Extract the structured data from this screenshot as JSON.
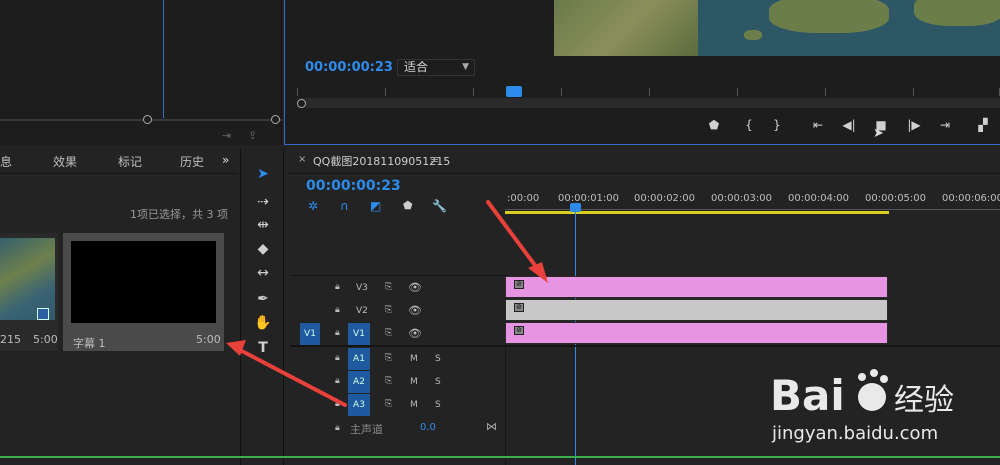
{
  "program_monitor": {
    "timecode": "00:00:00:23",
    "fit_label": "适合"
  },
  "project_panel": {
    "tabs": [
      "息",
      "效果",
      "标记",
      "历史"
    ],
    "more_label": "»",
    "selection_info": "1项已选择，共 3 项",
    "items": [
      {
        "name": "215",
        "duration": "5:00"
      },
      {
        "name": "字幕 1",
        "duration": "5:00"
      }
    ]
  },
  "timeline": {
    "tab_title": "QQ截图20181109051215",
    "close_label": "×",
    "menu_label": "≡",
    "timecode": "00:00:00:23",
    "ruler_labels": [
      ":00:00",
      "00:00:01:00",
      "00:00:02:00",
      "00:00:03:00",
      "00:00:04:00",
      "00:00:05:00",
      "00:00:06:00"
    ],
    "video_tracks": [
      {
        "id": "V3",
        "src": "",
        "clip_color": "#e795e2"
      },
      {
        "id": "V2",
        "src": "",
        "clip_color": "#c8c8c8"
      },
      {
        "id": "V1",
        "src": "V1",
        "clip_color": "#e795e2"
      }
    ],
    "audio_tracks": [
      {
        "id": "A1",
        "m": "M",
        "s": "S"
      },
      {
        "id": "A2",
        "m": "M",
        "s": "S"
      },
      {
        "id": "A3",
        "m": "M",
        "s": "S"
      }
    ],
    "master": {
      "label": "主声道",
      "value": "0.0"
    }
  },
  "colors": {
    "accent": "#2d8ceb",
    "annotation_arrow": "#e8403a",
    "work_area": "#d8d020"
  }
}
